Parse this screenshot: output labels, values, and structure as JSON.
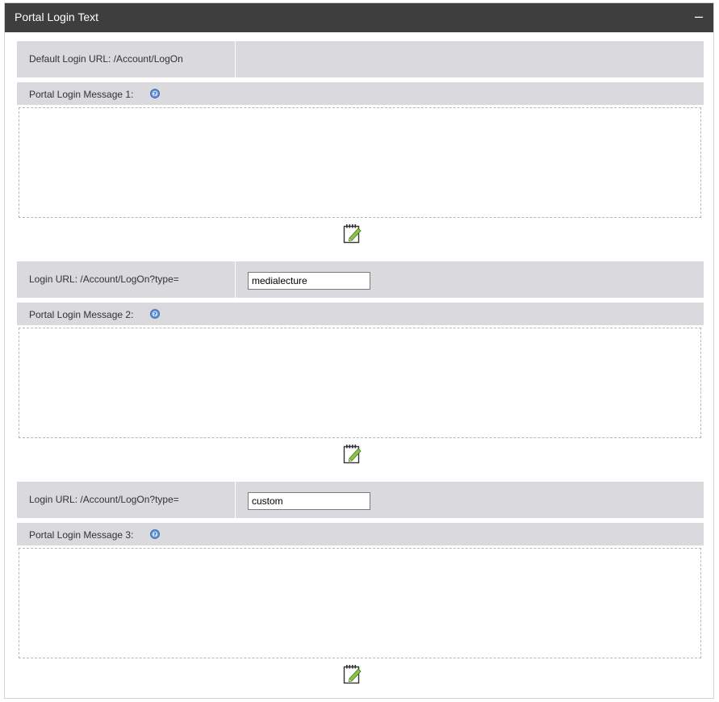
{
  "panel": {
    "title": "Portal Login Text",
    "collapse_symbol": "–"
  },
  "sections": [
    {
      "url_label": "Default Login URL: /Account/LogOn",
      "url_value": null,
      "message_label": "Portal Login Message 1:",
      "message_text": "",
      "help_icon": "help-icon",
      "edit_icon": "edit-notepad-icon"
    },
    {
      "url_label": "Login URL: /Account/LogOn?type=",
      "url_value": "medialecture",
      "message_label": "Portal Login Message 2:",
      "message_text": "",
      "help_icon": "help-icon",
      "edit_icon": "edit-notepad-icon"
    },
    {
      "url_label": "Login URL: /Account/LogOn?type=",
      "url_value": "custom",
      "message_label": "Portal Login Message 3:",
      "message_text": "",
      "help_icon": "help-icon",
      "edit_icon": "edit-notepad-icon"
    }
  ],
  "colors": {
    "header_bg": "#3e3e3e",
    "row_bg": "#d9d9de",
    "help_blue": "#3b78d8",
    "edit_green": "#7cb342"
  }
}
